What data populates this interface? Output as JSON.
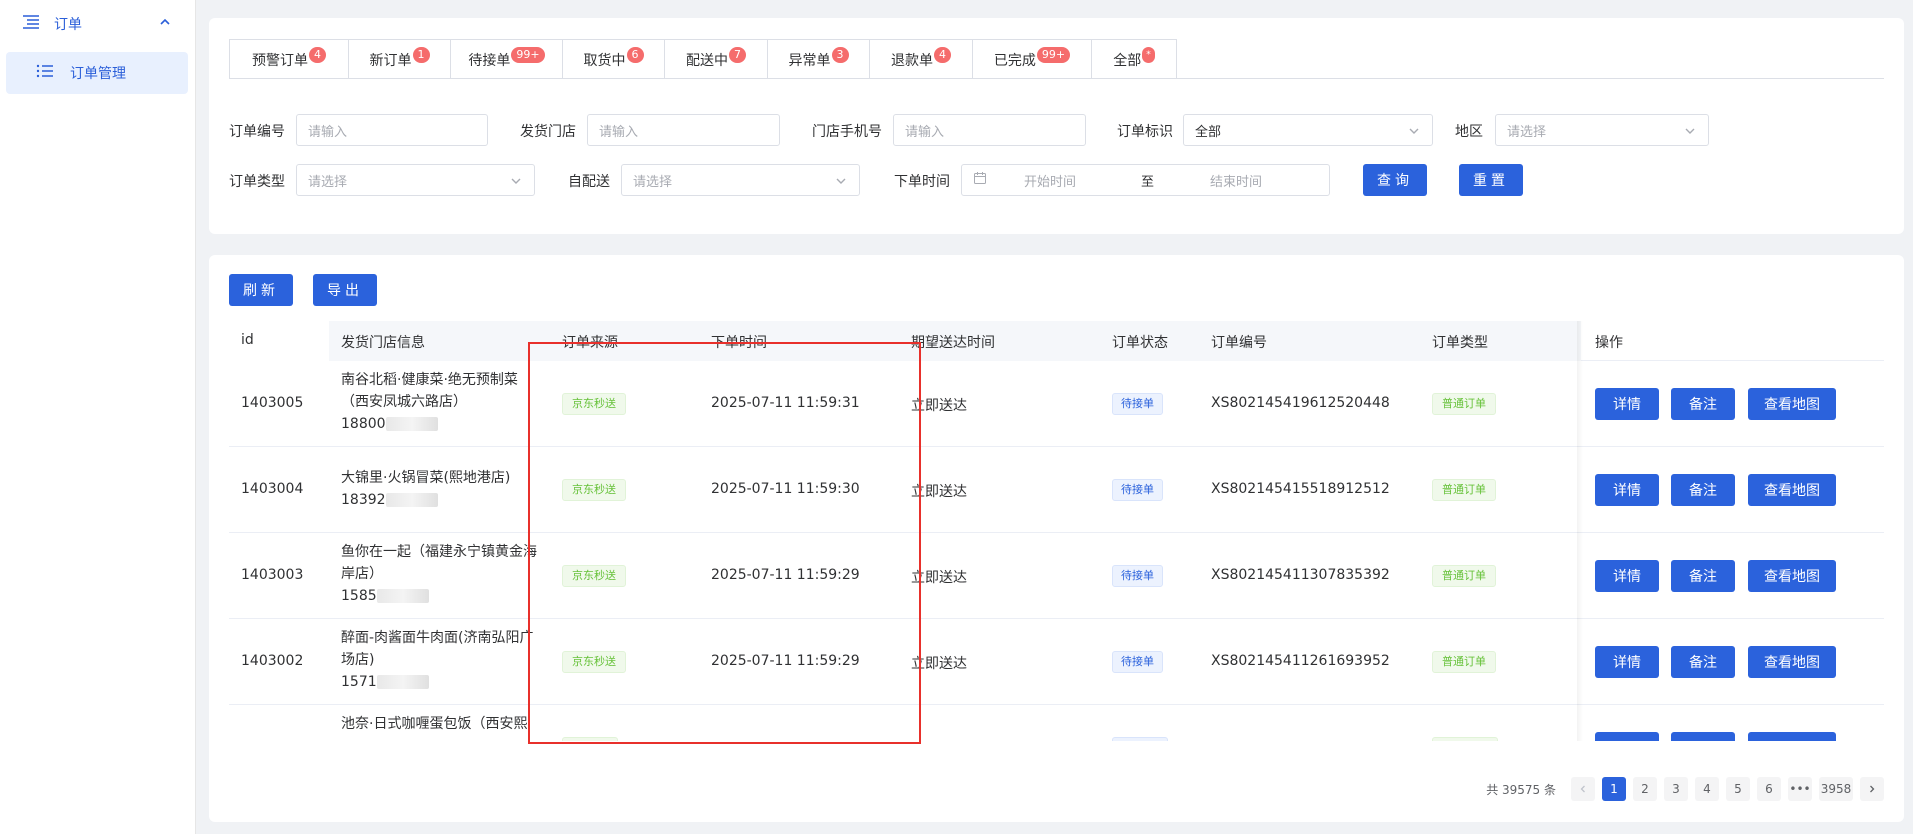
{
  "sidebar": {
    "group_label": "订单",
    "item_label": "订单管理"
  },
  "tabs": [
    {
      "label": "预警订单",
      "count": "4"
    },
    {
      "label": "新订单",
      "count": "1"
    },
    {
      "label": "待接单",
      "count": "99+"
    },
    {
      "label": "取货中",
      "count": "6"
    },
    {
      "label": "配送中",
      "count": "7"
    },
    {
      "label": "异常单",
      "count": "3"
    },
    {
      "label": "退款单",
      "count": "4"
    },
    {
      "label": "已完成",
      "count": "99+"
    },
    {
      "label": "全部",
      "count": "*"
    }
  ],
  "filters": {
    "order_no": {
      "label": "订单编号",
      "placeholder": "请输入"
    },
    "store": {
      "label": "发货门店",
      "placeholder": "请输入"
    },
    "phone": {
      "label": "门店手机号",
      "placeholder": "请输入"
    },
    "mark": {
      "label": "订单标识",
      "value": "全部"
    },
    "region": {
      "label": "地区",
      "placeholder": "请选择"
    },
    "type": {
      "label": "订单类型",
      "placeholder": "请选择"
    },
    "self_delivery": {
      "label": "自配送",
      "placeholder": "请选择"
    },
    "time": {
      "label": "下单时间",
      "start": "开始时间",
      "to": "至",
      "end": "结束时间"
    },
    "query_btn": "查询",
    "reset_btn": "重置"
  },
  "toolbar": {
    "refresh": "刷新",
    "export": "导出"
  },
  "table": {
    "headers": {
      "id": "id",
      "store": "发货门店信息",
      "source": "订单来源",
      "order_time": "下单时间",
      "expect_time": "期望送达时间",
      "status": "订单状态",
      "order_no": "订单编号",
      "type": "订单类型",
      "ops": "操作"
    },
    "rows": [
      {
        "id": "1403005",
        "store1": "南谷北稻·健康菜·绝无预制菜",
        "store2": "（西安凤城六路店）",
        "phone": "18800",
        "source": "京东秒送",
        "order_time": "2025-07-11 11:59:31",
        "expect": "立即送达",
        "status": "待接单",
        "order_no": "XS802145419612520448",
        "type": "普通订单"
      },
      {
        "id": "1403004",
        "store1": "大锦里·火锅冒菜(熙地港店)",
        "store2": "",
        "phone": "18392",
        "source": "京东秒送",
        "order_time": "2025-07-11 11:59:30",
        "expect": "立即送达",
        "status": "待接单",
        "order_no": "XS802145415518912512",
        "type": "普通订单"
      },
      {
        "id": "1403003",
        "store1": "鱼你在一起（福建永宁镇黄金海",
        "store2": "岸店）",
        "phone": "1585",
        "source": "京东秒送",
        "order_time": "2025-07-11 11:59:29",
        "expect": "立即送达",
        "status": "待接单",
        "order_no": "XS802145411307835392",
        "type": "普通订单"
      },
      {
        "id": "1403002",
        "store1": "醉面-肉酱面牛肉面(济南弘阳广",
        "store2": "场店)",
        "phone": "1571",
        "source": "京东秒送",
        "order_time": "2025-07-11 11:59:29",
        "expect": "立即送达",
        "status": "待接单",
        "order_no": "XS802145411261693952",
        "type": "普通订单"
      },
      {
        "id": "",
        "store1": "池奈·日式咖喱蛋包饭（西安熙",
        "store2": "",
        "phone": "",
        "source": "",
        "order_time": "",
        "expect": "",
        "status": "",
        "order_no": "",
        "type": ""
      }
    ],
    "ops": {
      "detail": "详情",
      "remark": "备注",
      "map": "查看地图"
    }
  },
  "pagination": {
    "total": "共 39575 条",
    "pages": [
      "1",
      "2",
      "3",
      "4",
      "5",
      "6",
      "•••",
      "3958"
    ]
  }
}
